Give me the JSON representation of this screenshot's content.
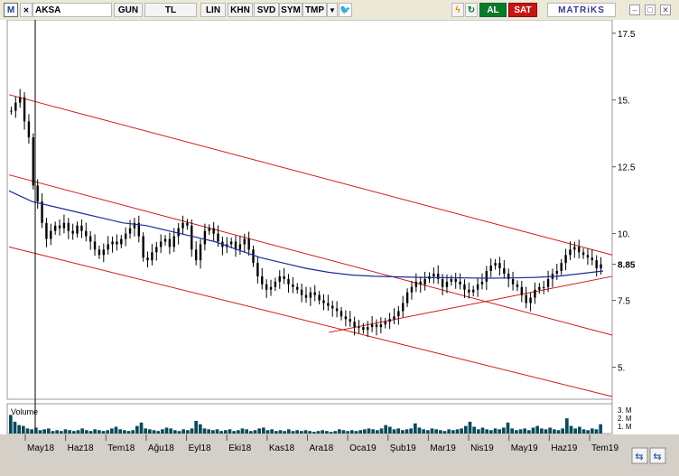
{
  "toolbar": {
    "m_label": "M",
    "symbol": "AKSA",
    "period": "GUN",
    "currency": "TL",
    "scale": "LIN",
    "btn_khn": "KHN",
    "btn_svd": "SVD",
    "btn_sym": "SYM",
    "btn_tmp": "TMP",
    "al": "AL",
    "sat": "SAT",
    "brand": "MATRiKS",
    "icons": [
      "dropdown-arrow-icon",
      "twitter-icon",
      "lightning-icon",
      "refresh-icon",
      "minimize-icon",
      "maximize-icon",
      "close-icon"
    ]
  },
  "chart_data": {
    "type": "candlestick",
    "symbol": "AKSA",
    "y_axis_ticks": [
      "17.5",
      "15.",
      "12.5",
      "10.",
      "8.85",
      "7.5",
      "5."
    ],
    "y_range": [
      3.8,
      18.0
    ],
    "last_price": "8.85",
    "x_axis_labels": [
      "May18",
      "Haz18",
      "Tem18",
      "Ağu18",
      "Eyl18",
      "Eki18",
      "Kas18",
      "Ara18",
      "Oca19",
      "Şub19",
      "Mar19",
      "Nis19",
      "May19",
      "Haz19",
      "Tem19"
    ],
    "close_series": [
      14.6,
      14.9,
      15.1,
      14.2,
      13.6,
      11.8,
      11.2,
      10.4,
      9.8,
      10.1,
      10.3,
      10.2,
      10.4,
      10.1,
      10.0,
      10.3,
      10.1,
      9.9,
      9.7,
      9.4,
      9.2,
      9.4,
      9.6,
      9.7,
      9.6,
      9.8,
      10.0,
      10.2,
      10.4,
      9.9,
      9.1,
      9.0,
      9.3,
      9.5,
      9.7,
      9.8,
      9.5,
      9.9,
      10.2,
      10.4,
      10.3,
      9.4,
      9.0,
      9.6,
      10.1,
      10.2,
      10.0,
      9.7,
      9.5,
      9.6,
      9.7,
      9.4,
      9.6,
      9.8,
      9.4,
      8.9,
      8.4,
      8.1,
      7.9,
      8.0,
      8.2,
      8.4,
      8.3,
      8.1,
      8.0,
      7.9,
      7.7,
      7.6,
      7.8,
      7.7,
      7.5,
      7.4,
      7.3,
      7.2,
      7.1,
      6.9,
      6.8,
      6.7,
      6.5,
      6.5,
      6.4,
      6.5,
      6.6,
      6.5,
      6.6,
      6.7,
      6.8,
      6.9,
      7.1,
      7.4,
      7.8,
      8.0,
      8.2,
      8.1,
      8.3,
      8.4,
      8.5,
      8.3,
      8.0,
      8.2,
      8.3,
      8.2,
      8.1,
      7.9,
      7.8,
      7.9,
      8.1,
      8.2,
      8.6,
      8.8,
      8.9,
      8.7,
      8.5,
      8.3,
      8.1,
      8.0,
      7.7,
      7.4,
      7.6,
      7.9,
      8.0,
      8.0,
      8.3,
      8.5,
      8.6,
      8.9,
      9.2,
      9.4,
      9.5,
      9.3,
      9.2,
      9.1,
      9.0,
      8.7,
      8.85
    ],
    "moving_average": [
      11.6,
      11.2,
      11.0,
      10.8,
      10.6,
      10.4,
      10.3,
      10.1,
      9.9,
      9.7,
      9.4,
      9.1,
      8.9,
      8.7,
      8.55,
      8.45,
      8.4,
      8.38,
      8.36,
      8.35,
      8.34,
      8.33,
      8.34,
      8.36,
      8.4,
      8.5,
      8.6
    ],
    "channel_outer_upper": [
      [
        0,
        15.2
      ],
      [
        1,
        9.2
      ]
    ],
    "channel_outer_lower": [
      [
        0,
        9.5
      ],
      [
        1,
        3.9
      ]
    ],
    "channel_inner_upper": [
      [
        0,
        12.2
      ],
      [
        1,
        6.2
      ]
    ],
    "support_line": [
      [
        0.53,
        6.3
      ],
      [
        1,
        8.4
      ]
    ],
    "volume_label": "Volume",
    "volume_axis_labels": [
      "3. M",
      "2. M",
      "1. M"
    ],
    "volume_series": [
      2.2,
      1.4,
      1.0,
      0.9,
      0.6,
      0.5,
      0.7,
      0.4,
      0.5,
      0.6,
      0.3,
      0.4,
      0.3,
      0.5,
      0.4,
      0.3,
      0.4,
      0.6,
      0.4,
      0.3,
      0.5,
      0.4,
      0.3,
      0.4,
      0.6,
      0.8,
      0.5,
      0.4,
      0.3,
      0.4,
      0.9,
      1.3,
      0.6,
      0.5,
      0.4,
      0.3,
      0.5,
      0.7,
      0.6,
      0.4,
      0.3,
      0.5,
      0.4,
      0.6,
      1.5,
      1.1,
      0.6,
      0.5,
      0.4,
      0.5,
      0.3,
      0.4,
      0.5,
      0.3,
      0.4,
      0.6,
      0.5,
      0.3,
      0.4,
      0.6,
      0.7,
      0.4,
      0.5,
      0.3,
      0.4,
      0.3,
      0.5,
      0.3,
      0.4,
      0.3,
      0.4,
      0.3,
      0.2,
      0.3,
      0.4,
      0.3,
      0.2,
      0.3,
      0.5,
      0.4,
      0.3,
      0.4,
      0.3,
      0.4,
      0.5,
      0.6,
      0.5,
      0.4,
      0.6,
      1.0,
      0.8,
      0.5,
      0.6,
      0.4,
      0.5,
      0.6,
      1.2,
      0.7,
      0.5,
      0.4,
      0.6,
      0.5,
      0.4,
      0.3,
      0.5,
      0.4,
      0.5,
      0.6,
      0.9,
      1.4,
      0.8,
      0.5,
      0.7,
      0.5,
      0.4,
      0.6,
      0.5,
      0.7,
      1.3,
      0.6,
      0.4,
      0.5,
      0.6,
      0.4,
      0.7,
      0.9,
      0.6,
      0.5,
      0.7,
      0.5,
      0.4,
      0.6,
      1.8,
      0.9,
      0.6,
      0.8,
      0.5,
      0.4,
      0.6,
      0.5,
      1.1
    ],
    "colors": {
      "candle": "#000000",
      "moving_average": "#1c2a9c",
      "trend_lines": "#d01818",
      "volume_bars": "#0a4a5a",
      "background": "#ffffff"
    }
  }
}
